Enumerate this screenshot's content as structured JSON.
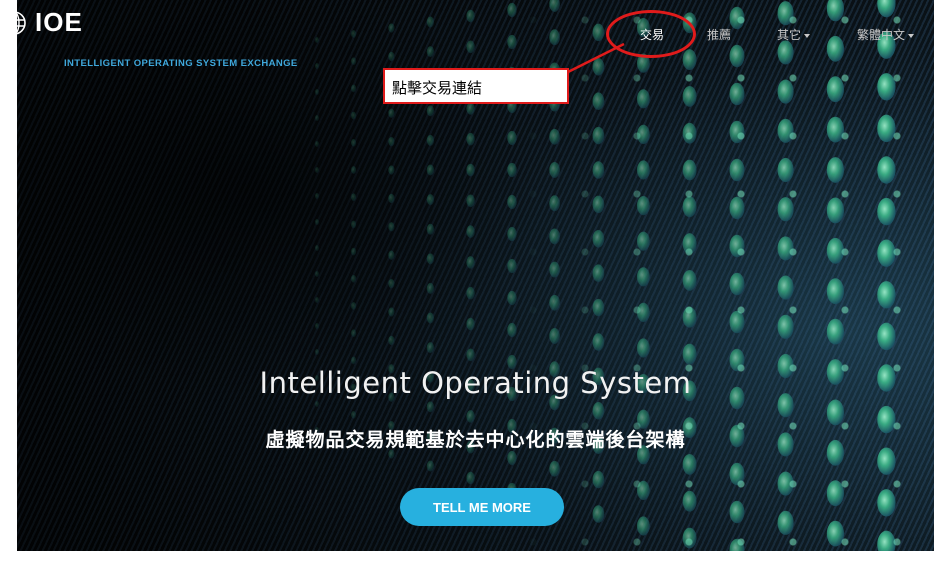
{
  "brand": {
    "name": "IOE",
    "tagline": "INTELLIGENT OPERATING SYSTEM EXCHANGE",
    "icon": "globe-icon"
  },
  "nav": {
    "trade": "交易",
    "recommend": "推薦",
    "other": "其它",
    "language": "繁體中文"
  },
  "annotation": {
    "text": "點擊交易連結",
    "color": "#e01b1b"
  },
  "hero": {
    "title": "Intelligent Operating System",
    "subtitle": "虛擬物品交易規範基於去中心化的雲端後台架構",
    "cta": "TELL ME MORE",
    "cta_color": "#27b0df"
  }
}
